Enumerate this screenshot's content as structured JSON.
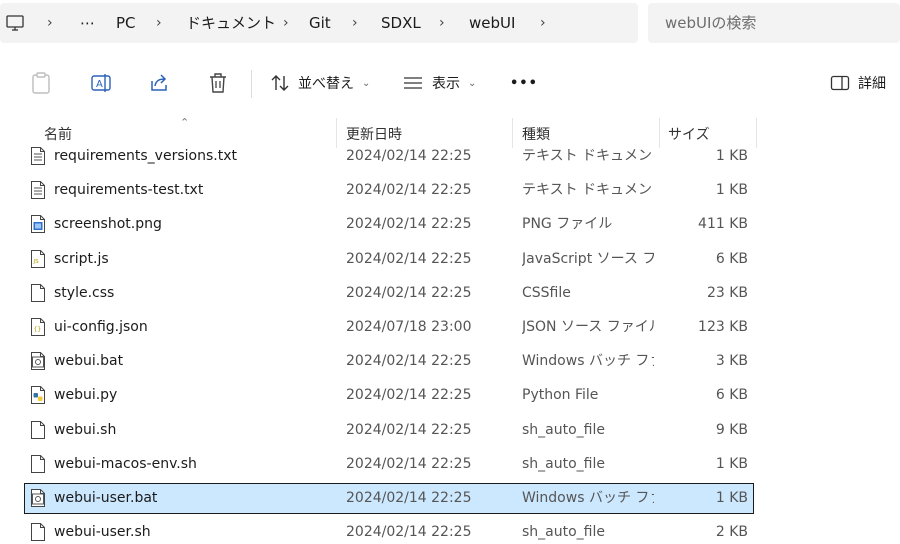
{
  "breadcrumb": {
    "items": [
      "⋯",
      "PC",
      "ドキュメント",
      "Git",
      "SDXL",
      "webUI"
    ]
  },
  "search": {
    "placeholder": "webUIの検索"
  },
  "toolbar": {
    "sort_label": "並べ替え",
    "view_label": "表示",
    "more_label": "•••",
    "details_label": "詳細"
  },
  "columns": {
    "name": "名前",
    "date": "更新日時",
    "type": "種類",
    "size": "サイズ"
  },
  "files": [
    {
      "name": "requirements_versions.txt",
      "date": "2024/02/14 22:25",
      "type": "テキスト ドキュメント",
      "size": "1 KB",
      "icon": "text-file-icon"
    },
    {
      "name": "requirements-test.txt",
      "date": "2024/02/14 22:25",
      "type": "テキスト ドキュメント",
      "size": "1 KB",
      "icon": "text-file-icon"
    },
    {
      "name": "screenshot.png",
      "date": "2024/02/14 22:25",
      "type": "PNG ファイル",
      "size": "411 KB",
      "icon": "image-file-icon"
    },
    {
      "name": "script.js",
      "date": "2024/02/14 22:25",
      "type": "JavaScript ソース フ...",
      "size": "6 KB",
      "icon": "js-file-icon"
    },
    {
      "name": "style.css",
      "date": "2024/02/14 22:25",
      "type": "CSSfile",
      "size": "23 KB",
      "icon": "blank-file-icon"
    },
    {
      "name": "ui-config.json",
      "date": "2024/07/18 23:00",
      "type": "JSON ソース ファイル",
      "size": "123 KB",
      "icon": "json-file-icon"
    },
    {
      "name": "webui.bat",
      "date": "2024/02/14 22:25",
      "type": "Windows バッチ ファ...",
      "size": "3 KB",
      "icon": "batch-file-icon"
    },
    {
      "name": "webui.py",
      "date": "2024/02/14 22:25",
      "type": "Python File",
      "size": "6 KB",
      "icon": "python-file-icon"
    },
    {
      "name": "webui.sh",
      "date": "2024/02/14 22:25",
      "type": "sh_auto_file",
      "size": "9 KB",
      "icon": "blank-file-icon"
    },
    {
      "name": "webui-macos-env.sh",
      "date": "2024/02/14 22:25",
      "type": "sh_auto_file",
      "size": "1 KB",
      "icon": "blank-file-icon"
    },
    {
      "name": "webui-user.bat",
      "date": "2024/02/14 22:25",
      "type": "Windows バッチ ファ...",
      "size": "1 KB",
      "icon": "batch-file-icon",
      "selected": true
    },
    {
      "name": "webui-user.sh",
      "date": "2024/02/14 22:25",
      "type": "sh_auto_file",
      "size": "2 KB",
      "icon": "blank-file-icon"
    }
  ],
  "colors": {
    "selection": "#cce8ff",
    "addressbar": "#f3f3f3",
    "accent": "#0067c0"
  }
}
